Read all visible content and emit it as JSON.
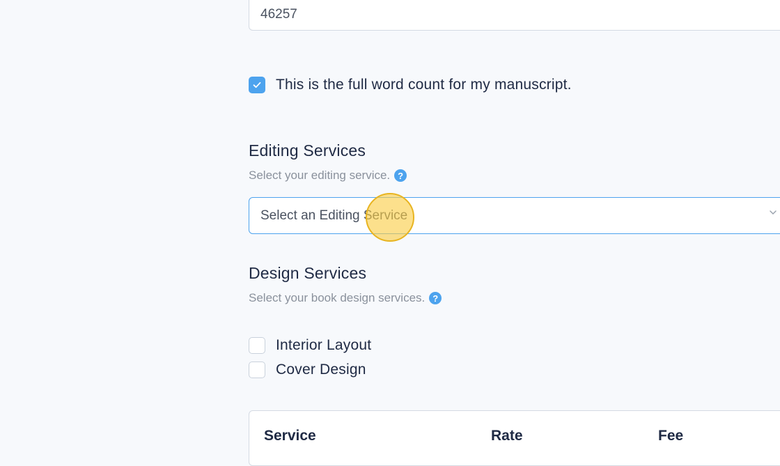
{
  "word_count": {
    "value": "46257"
  },
  "full_count_checkbox": {
    "checked": true,
    "label": "This is the full word count for my manuscript."
  },
  "editing": {
    "title": "Editing Services",
    "hint": "Select your editing service.",
    "help_glyph": "?",
    "select": {
      "selected": "Select an Editing Service"
    }
  },
  "design": {
    "title": "Design Services",
    "hint": "Select your book design services.",
    "help_glyph": "?",
    "options": [
      {
        "label": "Interior Layout",
        "checked": false
      },
      {
        "label": "Cover Design",
        "checked": false
      }
    ]
  },
  "table": {
    "columns": [
      "Service",
      "Rate",
      "Fee"
    ]
  },
  "colors": {
    "accent": "#4da3ee",
    "text": "#1f2a44",
    "muted": "#8a919c",
    "background": "#f7f9fc",
    "cursor_highlight": "#f7c948"
  }
}
